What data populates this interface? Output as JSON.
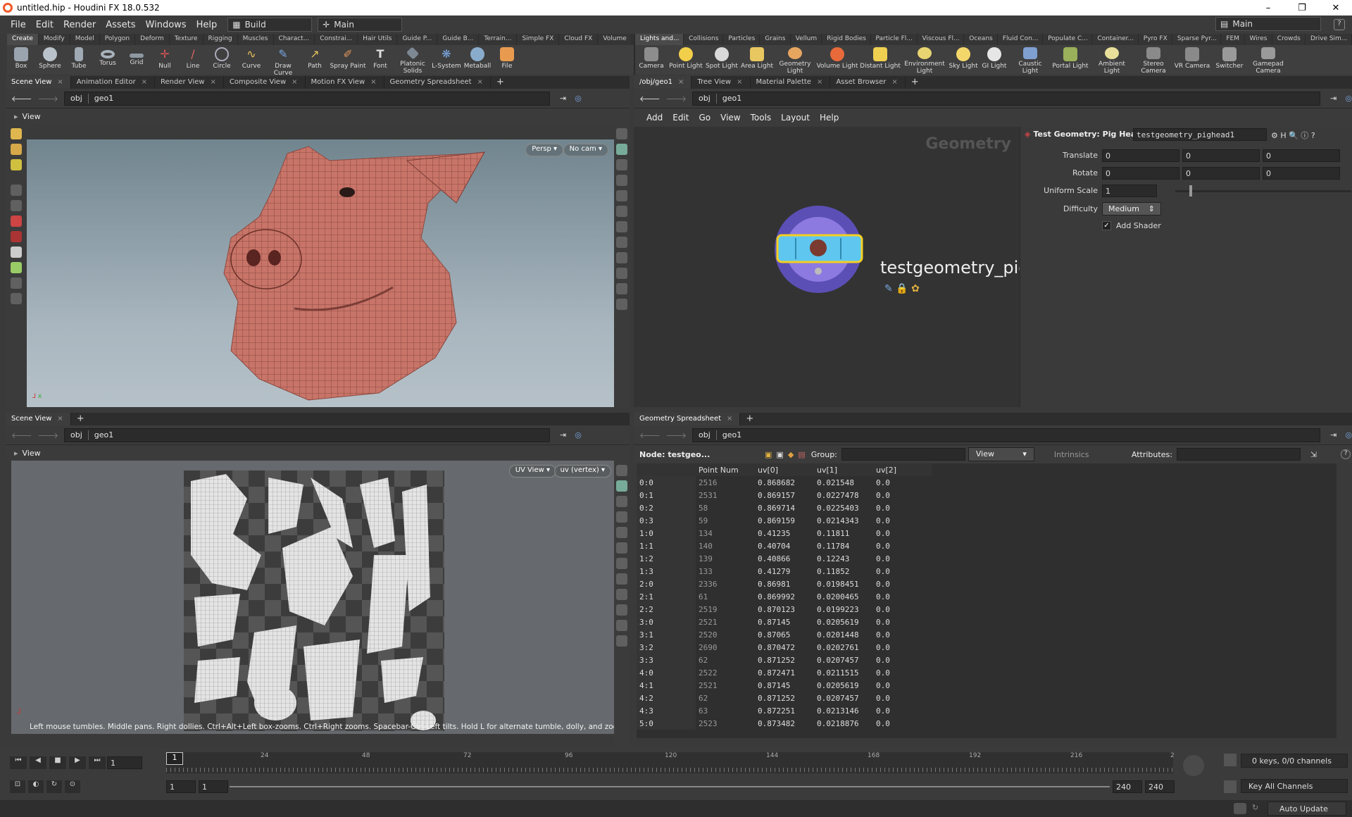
{
  "window": {
    "title": "untitled.hip - Houdini FX 18.0.532",
    "min": "–",
    "max": "❐",
    "close": "✕"
  },
  "menu": [
    "File",
    "Edit",
    "Render",
    "Assets",
    "Windows",
    "Help"
  ],
  "desktops": {
    "build": "Build",
    "main": "Main",
    "right": "Main"
  },
  "shelf_left": {
    "tabs": [
      "Create",
      "Modify",
      "Model",
      "Polygon",
      "Deform",
      "Texture",
      "Rigging",
      "Muscles",
      "Charact...",
      "Constrai...",
      "Hair Utils",
      "Guide P...",
      "Guide B...",
      "Terrain...",
      "Simple FX",
      "Cloud FX",
      "Volume"
    ],
    "tools": [
      "Box",
      "Sphere",
      "Tube",
      "Torus",
      "Grid",
      "Null",
      "Line",
      "Circle",
      "Curve",
      "Draw Curve",
      "Path",
      "Spray Paint",
      "Font",
      "Platonic Solids",
      "L-System",
      "Metaball",
      "File"
    ]
  },
  "shelf_right": {
    "tabs": [
      "Lights and...",
      "Collisions",
      "Particles",
      "Grains",
      "Vellum",
      "Rigid Bodies",
      "Particle Fl...",
      "Viscous Fl...",
      "Oceans",
      "Fluid Con...",
      "Populate C...",
      "Container...",
      "Pyro FX",
      "Sparse Pyr...",
      "FEM",
      "Wires",
      "Crowds",
      "Drive Sim..."
    ],
    "tools": [
      "Camera",
      "Point Light",
      "Spot Light",
      "Area Light",
      "Geometry Light",
      "Volume Light",
      "Distant Light",
      "Environment Light",
      "Sky Light",
      "GI Light",
      "Caustic Light",
      "Portal Light",
      "Ambient Light",
      "Stereo Camera",
      "VR Camera",
      "Switcher",
      "Gamepad Camera"
    ]
  },
  "top_left_pane": {
    "tabs": [
      "Scene View",
      "Animation Editor",
      "Render View",
      "Composite View",
      "Motion FX View",
      "Geometry Spreadsheet"
    ],
    "path": [
      "obj",
      "geo1"
    ],
    "view_label": "View",
    "persp": "Persp ▾",
    "cam": "No cam ▾"
  },
  "bottom_left_pane": {
    "tabs": [
      "Scene View"
    ],
    "path": [
      "obj",
      "geo1"
    ],
    "view_label": "View",
    "uvview": "UV View ▾",
    "uvattr": "uv (vertex) ▾",
    "hint": "Left mouse tumbles. Middle pans. Right dollies. Ctrl+Alt+Left box-zooms. Ctrl+Right zooms. Spacebar-Ctrl-Left tilts. Hold L for alternate tumble, dolly, and zoom."
  },
  "network_pane": {
    "tabs": [
      "/obj/geo1",
      "Tree View",
      "Material Palette",
      "Asset Browser"
    ],
    "path": [
      "obj",
      "geo1"
    ],
    "menus": [
      "Add",
      "Edit",
      "Go",
      "View",
      "Tools",
      "Layout",
      "Help"
    ],
    "context_label": "Geometry",
    "node_name": "testgeometry_pig"
  },
  "parms": {
    "node_type": "Test Geometry: Pig Head",
    "node_name": "testgeometry_pighead1",
    "translate_label": "Translate",
    "translate": [
      "0",
      "0",
      "0"
    ],
    "rotate_label": "Rotate",
    "rotate": [
      "0",
      "0",
      "0"
    ],
    "scale_label": "Uniform Scale",
    "scale": "1",
    "difficulty_label": "Difficulty",
    "difficulty": "Medium",
    "shader_label": "Add Shader",
    "shader_checked": true
  },
  "spreadsheet": {
    "tabs": [
      "Geometry Spreadsheet"
    ],
    "path": [
      "obj",
      "geo1"
    ],
    "node": "Node: testgeo...",
    "group_label": "Group:",
    "view": "View",
    "intrinsics": "Intrinsics",
    "attributes_label": "Attributes:",
    "columns": [
      "",
      "Point Num",
      "uv[0]",
      "uv[1]",
      "uv[2]"
    ],
    "rows": [
      [
        "0:0",
        "2516",
        "0.868682",
        "0.021548",
        "0.0"
      ],
      [
        "0:1",
        "2531",
        "0.869157",
        "0.0227478",
        "0.0"
      ],
      [
        "0:2",
        "58",
        "0.869714",
        "0.0225403",
        "0.0"
      ],
      [
        "0:3",
        "59",
        "0.869159",
        "0.0214343",
        "0.0"
      ],
      [
        "1:0",
        "134",
        "0.41235",
        "0.11811",
        "0.0"
      ],
      [
        "1:1",
        "140",
        "0.40704",
        "0.11784",
        "0.0"
      ],
      [
        "1:2",
        "139",
        "0.40866",
        "0.12243",
        "0.0"
      ],
      [
        "1:3",
        "133",
        "0.41279",
        "0.11852",
        "0.0"
      ],
      [
        "2:0",
        "2336",
        "0.86981",
        "0.0198451",
        "0.0"
      ],
      [
        "2:1",
        "61",
        "0.869992",
        "0.0200465",
        "0.0"
      ],
      [
        "2:2",
        "2519",
        "0.870123",
        "0.0199223",
        "0.0"
      ],
      [
        "3:0",
        "2521",
        "0.87145",
        "0.0205619",
        "0.0"
      ],
      [
        "3:1",
        "2520",
        "0.87065",
        "0.0201448",
        "0.0"
      ],
      [
        "3:2",
        "2690",
        "0.870472",
        "0.0202761",
        "0.0"
      ],
      [
        "3:3",
        "62",
        "0.871252",
        "0.0207457",
        "0.0"
      ],
      [
        "4:0",
        "2522",
        "0.872471",
        "0.0211515",
        "0.0"
      ],
      [
        "4:1",
        "2521",
        "0.87145",
        "0.0205619",
        "0.0"
      ],
      [
        "4:2",
        "62",
        "0.871252",
        "0.0207457",
        "0.0"
      ],
      [
        "4:3",
        "63",
        "0.872251",
        "0.0213146",
        "0.0"
      ],
      [
        "5:0",
        "2523",
        "0.873482",
        "0.0218876",
        "0.0"
      ]
    ]
  },
  "timeline": {
    "frame": "1",
    "marker": "1",
    "ticks": [
      "24",
      "48",
      "72",
      "96",
      "120",
      "144",
      "168",
      "192",
      "216",
      "2"
    ],
    "start1": "1",
    "start2": "1",
    "end1": "240",
    "end2": "240",
    "keys": "0 keys, 0/0 channels",
    "key_all": "Key All Channels"
  },
  "status": {
    "auto_update": "Auto Update"
  },
  "colors": {
    "accent": "#f05a28",
    "node_ring": "#7b5fd6",
    "node_body": "#5fc6ef",
    "node_outline": "#f3d021",
    "mesh": "#c87468"
  }
}
